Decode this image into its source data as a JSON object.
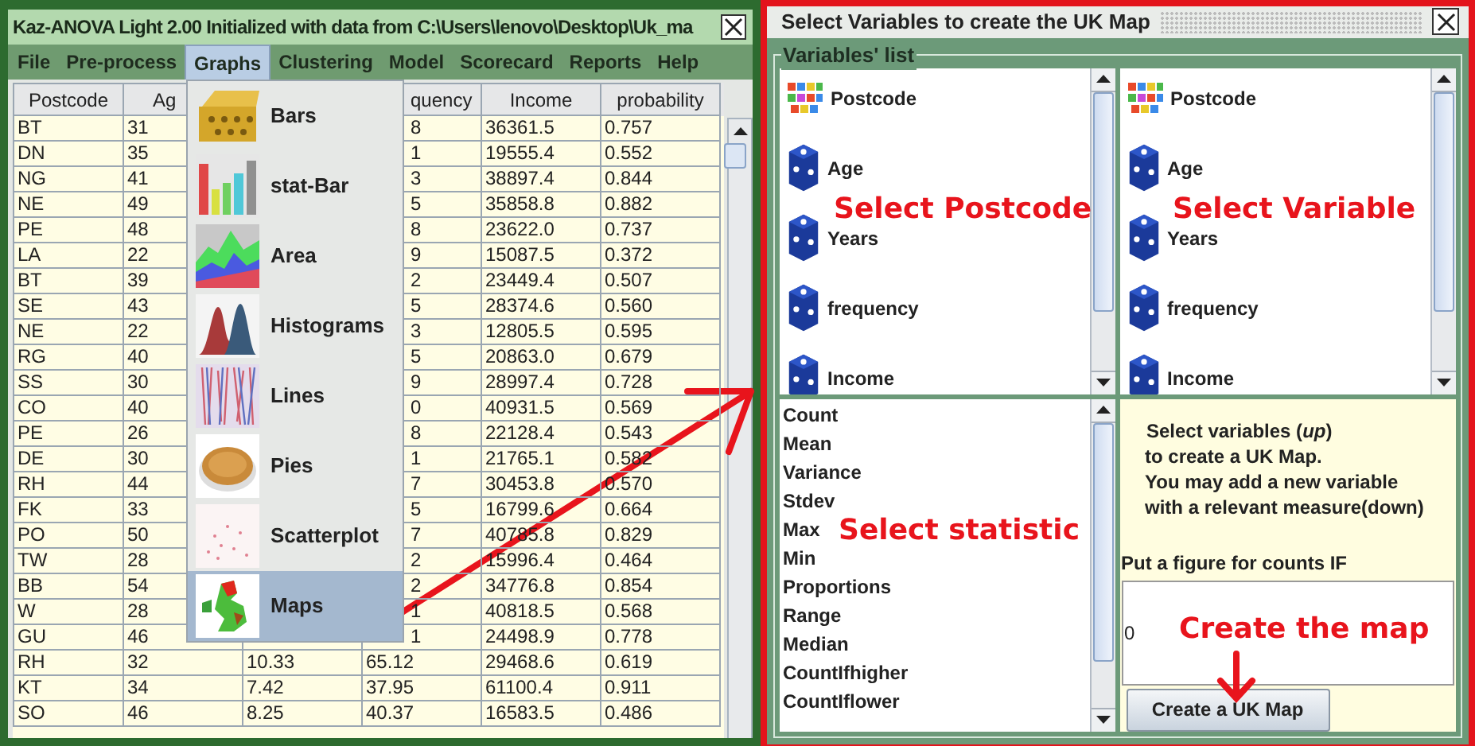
{
  "main_window": {
    "title": "Kaz-ANOVA Light 2.00 Initialized with data from C:\\Users\\lenovo\\Desktop\\Uk_ma",
    "menu": [
      {
        "label": "File",
        "selected": false
      },
      {
        "label": "Pre-process",
        "selected": false
      },
      {
        "label": "Graphs",
        "selected": true
      },
      {
        "label": "Clustering",
        "selected": false
      },
      {
        "label": "Model",
        "selected": false
      },
      {
        "label": "Scorecard",
        "selected": false
      },
      {
        "label": "Reports",
        "selected": false
      },
      {
        "label": "Help",
        "selected": false
      }
    ],
    "graphs_menu": [
      {
        "label": "Bars",
        "kind": "bars",
        "selected": false
      },
      {
        "label": "stat-Bar",
        "kind": "statbar",
        "selected": false
      },
      {
        "label": "Area",
        "kind": "area",
        "selected": false
      },
      {
        "label": "Histograms",
        "kind": "histograms",
        "selected": false
      },
      {
        "label": "Lines",
        "kind": "lines",
        "selected": false
      },
      {
        "label": "Pies",
        "kind": "pies",
        "selected": false
      },
      {
        "label": "Scatterplot",
        "kind": "scatter",
        "selected": false
      },
      {
        "label": "Maps",
        "kind": "maps",
        "selected": true
      }
    ],
    "table": {
      "headers": {
        "postcode": "Postcode",
        "age": "Ag",
        "frequency": "quency",
        "income": "Income",
        "probability": "probability"
      },
      "rows": [
        {
          "postcode": "BT",
          "age": "31",
          "frequency": "8",
          "income": "36361.5",
          "probability": "0.757"
        },
        {
          "postcode": "DN",
          "age": "35",
          "frequency": "1",
          "income": "19555.4",
          "probability": "0.552"
        },
        {
          "postcode": "NG",
          "age": "41",
          "frequency": "3",
          "income": "38897.4",
          "probability": "0.844"
        },
        {
          "postcode": "NE",
          "age": "49",
          "frequency": "5",
          "income": "35858.8",
          "probability": "0.882"
        },
        {
          "postcode": "PE",
          "age": "48",
          "frequency": "8",
          "income": "23622.0",
          "probability": "0.737"
        },
        {
          "postcode": "LA",
          "age": "22",
          "frequency": "9",
          "income": "15087.5",
          "probability": "0.372"
        },
        {
          "postcode": "BT",
          "age": "39",
          "frequency": "2",
          "income": "23449.4",
          "probability": "0.507"
        },
        {
          "postcode": "SE",
          "age": "43",
          "frequency": "5",
          "income": "28374.6",
          "probability": "0.560"
        },
        {
          "postcode": "NE",
          "age": "22",
          "frequency": "3",
          "income": "12805.5",
          "probability": "0.595"
        },
        {
          "postcode": "RG",
          "age": "40",
          "frequency": "5",
          "income": "20863.0",
          "probability": "0.679"
        },
        {
          "postcode": "SS",
          "age": "30",
          "frequency": "9",
          "income": "28997.4",
          "probability": "0.728"
        },
        {
          "postcode": "CO",
          "age": "40",
          "frequency": "0",
          "income": "40931.5",
          "probability": "0.569"
        },
        {
          "postcode": "PE",
          "age": "26",
          "frequency": "8",
          "income": "22128.4",
          "probability": "0.543"
        },
        {
          "postcode": "DE",
          "age": "30",
          "frequency": "1",
          "income": "21765.1",
          "probability": "0.582"
        },
        {
          "postcode": "RH",
          "age": "44",
          "frequency": "7",
          "income": "30453.8",
          "probability": "0.570"
        },
        {
          "postcode": "FK",
          "age": "33",
          "frequency": "5",
          "income": "16799.6",
          "probability": "0.664"
        },
        {
          "postcode": "PO",
          "age": "50",
          "frequency": "7",
          "income": "40785.8",
          "probability": "0.829"
        },
        {
          "postcode": "TW",
          "age": "28",
          "frequency": "2",
          "income": "15996.4",
          "probability": "0.464"
        },
        {
          "postcode": "BB",
          "age": "54",
          "frequency": "2",
          "income": "34776.8",
          "probability": "0.854"
        },
        {
          "postcode": "W",
          "age": "28",
          "frequency": "1",
          "income": "40818.5",
          "probability": "0.568"
        },
        {
          "postcode": "GU",
          "age": "46",
          "frequency": "1",
          "income": "24498.9",
          "probability": "0.778"
        },
        {
          "postcode": "RH",
          "age": "32",
          "column_3": "10.33",
          "frequency": "65.12",
          "income": "29468.6",
          "probability": "0.619"
        },
        {
          "postcode": "KT",
          "age": "34",
          "column_3": "7.42",
          "frequency": "37.95",
          "income": "61100.4",
          "probability": "0.911"
        },
        {
          "postcode": "SO",
          "age": "46",
          "column_3": "8.25",
          "frequency": "40.37",
          "income": "16583.5",
          "probability": "0.486"
        }
      ]
    }
  },
  "dialog": {
    "title": "Select Variables to create the UK Map",
    "group_label": "Variables' list",
    "left_variables": [
      {
        "label": "Postcode",
        "kind": "text"
      },
      {
        "label": "Age",
        "kind": "numeric"
      },
      {
        "label": "Years",
        "kind": "numeric"
      },
      {
        "label": "frequency",
        "kind": "numeric"
      },
      {
        "label": "Income",
        "kind": "numeric"
      }
    ],
    "right_variables": [
      {
        "label": "Postcode",
        "kind": "text"
      },
      {
        "label": "Age",
        "kind": "numeric"
      },
      {
        "label": "Years",
        "kind": "numeric"
      },
      {
        "label": "frequency",
        "kind": "numeric"
      },
      {
        "label": "Income",
        "kind": "numeric"
      }
    ],
    "statistics": [
      "Count",
      "Mean",
      "Variance",
      "Stdev",
      "Max",
      "Min",
      "Proportions",
      "Range",
      "Median",
      "CountIfhigher",
      "CountIflower"
    ],
    "instructions": [
      "Select variables (*up*)",
      "to create a UK Map.",
      "You may add a new variable",
      "with a relevant measure(down)"
    ],
    "counts_label": "Put a figure for counts IF",
    "counts_value": "0",
    "create_button": "Create a UK Map"
  },
  "annotations": [
    {
      "text": "Select Postcode"
    },
    {
      "text": "Select Variable"
    },
    {
      "text": "Select statistic"
    },
    {
      "text": "Create the map"
    }
  ]
}
